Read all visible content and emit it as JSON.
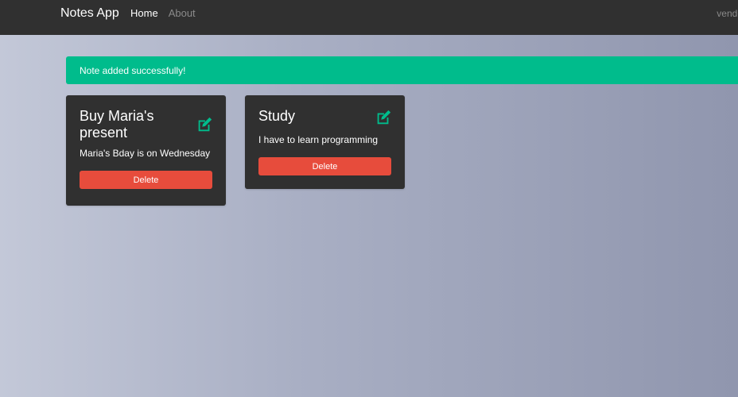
{
  "navbar": {
    "brand": "Notes App",
    "links": [
      {
        "label": "Home",
        "active": true
      },
      {
        "label": "About",
        "active": false
      }
    ],
    "user": "vende"
  },
  "alert": {
    "message": "Note added successfully!",
    "color": "#00bc8c"
  },
  "notes": [
    {
      "title": "Buy Maria's present",
      "description": "Maria's Bday is on Wednesday",
      "delete_label": "Delete",
      "edit_icon": "edit-icon"
    },
    {
      "title": "Study",
      "description": "I have to learn programming",
      "delete_label": "Delete",
      "edit_icon": "edit-icon"
    }
  ],
  "colors": {
    "accent": "#00bc8c",
    "danger": "#e74c3c",
    "card_bg": "#303030"
  }
}
